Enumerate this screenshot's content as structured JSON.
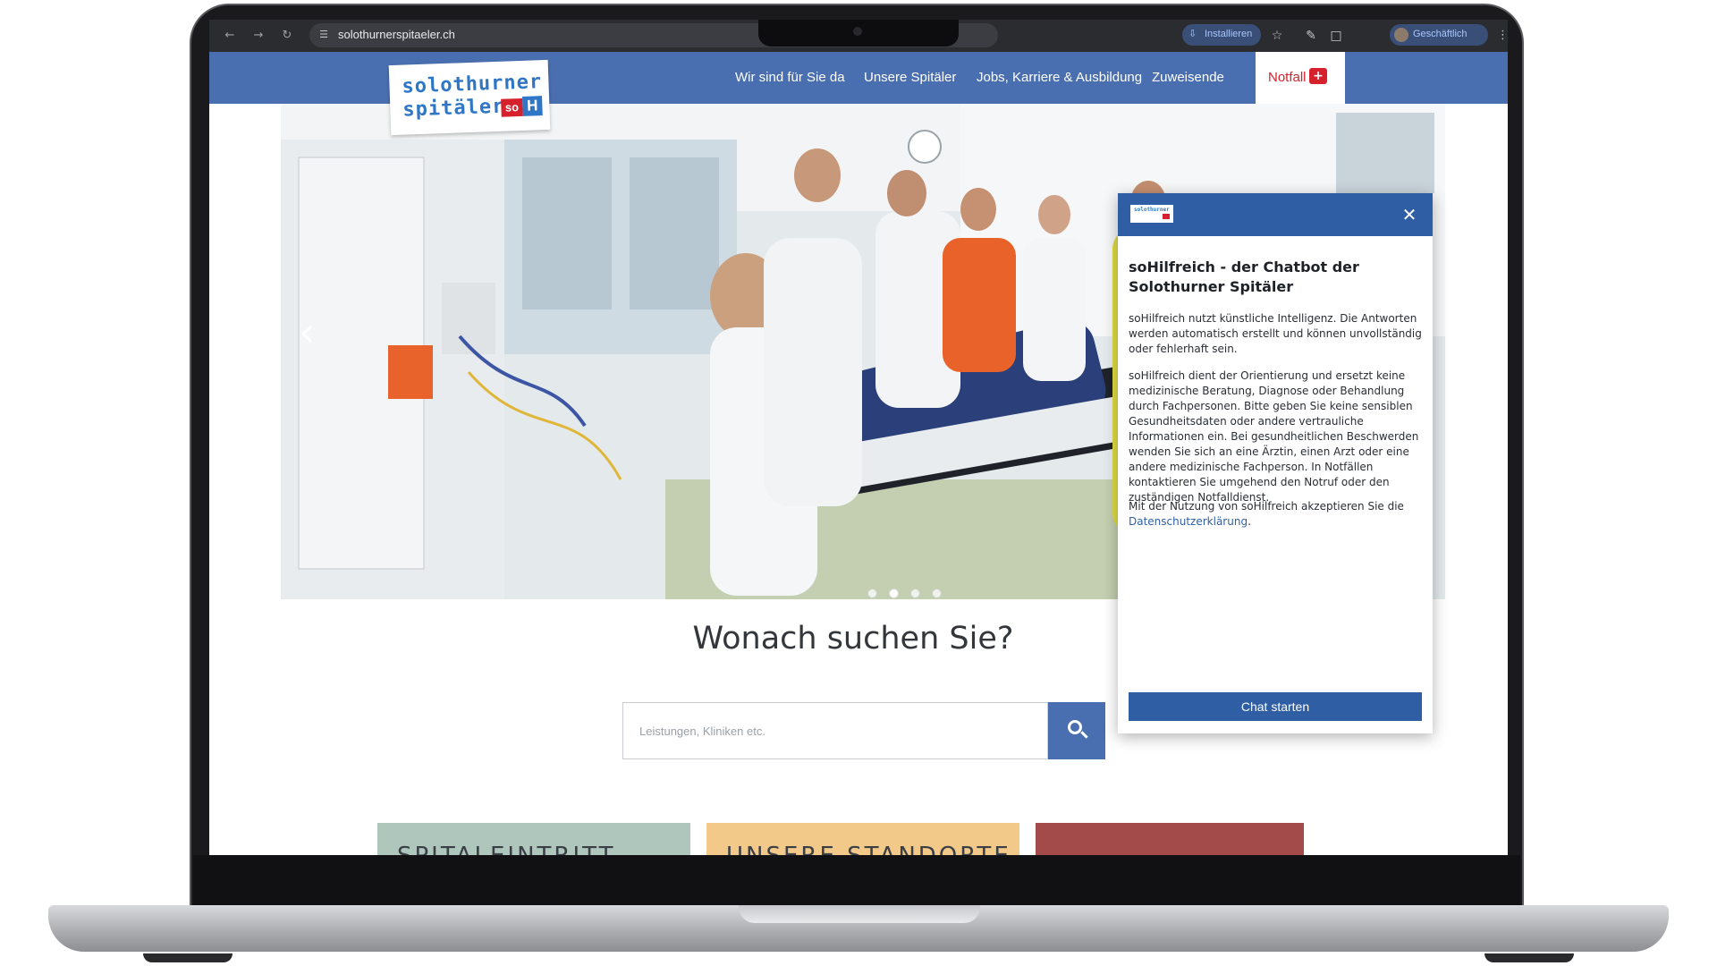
{
  "browser": {
    "url": "solothurnerspitaeler.ch",
    "install_label": "Installieren",
    "profile_label": "Geschäftlich"
  },
  "site": {
    "logo_line1": "solothurner",
    "logo_line2": "spitäler",
    "logo_so": "so",
    "logo_h": "H",
    "nav": [
      "Wir sind für Sie da",
      "Unsere Spitäler",
      "Jobs, Karriere & Ausbildung",
      "Zuweisende"
    ],
    "emergency_label": "Notfall"
  },
  "hero": {
    "active_slide": 2,
    "slide_count": 4
  },
  "search": {
    "title": "Wonach suchen Sie?",
    "placeholder": "Leistungen, Kliniken etc."
  },
  "cards": [
    "SPITALEINTRITT",
    "UNSERE STANDORTE"
  ],
  "chatbot": {
    "title": "soHilfreich - der Chatbot der Solothurner Spitäler",
    "paragraph1": "soHilfreich nutzt künstliche Intelligenz. Die Antworten werden automatisch erstellt und können unvollständig oder fehlerhaft sein.",
    "paragraph2": "soHilfreich dient der Orientierung und ersetzt keine medizinische Beratung, Diagnose oder Behandlung durch Fachpersonen. Bitte geben Sie keine sensiblen Gesundheitsdaten oder andere vertrauliche Informationen ein. Bei gesundheitlichen Beschwerden wenden Sie sich an eine Ärztin, einen Arzt oder eine andere medizinische Fachperson. In Notfällen kontaktieren Sie umgehend den Notruf oder den zuständigen Notfalldienst.",
    "paragraph3_prefix": "Mit der Nutzung von soHilfreich akzeptieren Sie die",
    "privacy_link": "Datenschutzerklärung",
    "paragraph3_suffix": ".",
    "start_button": "Chat starten"
  },
  "colors": {
    "brand_blue": "#4a6fb0",
    "chat_blue": "#2f5ea5",
    "emergency_red": "#d6202c"
  }
}
